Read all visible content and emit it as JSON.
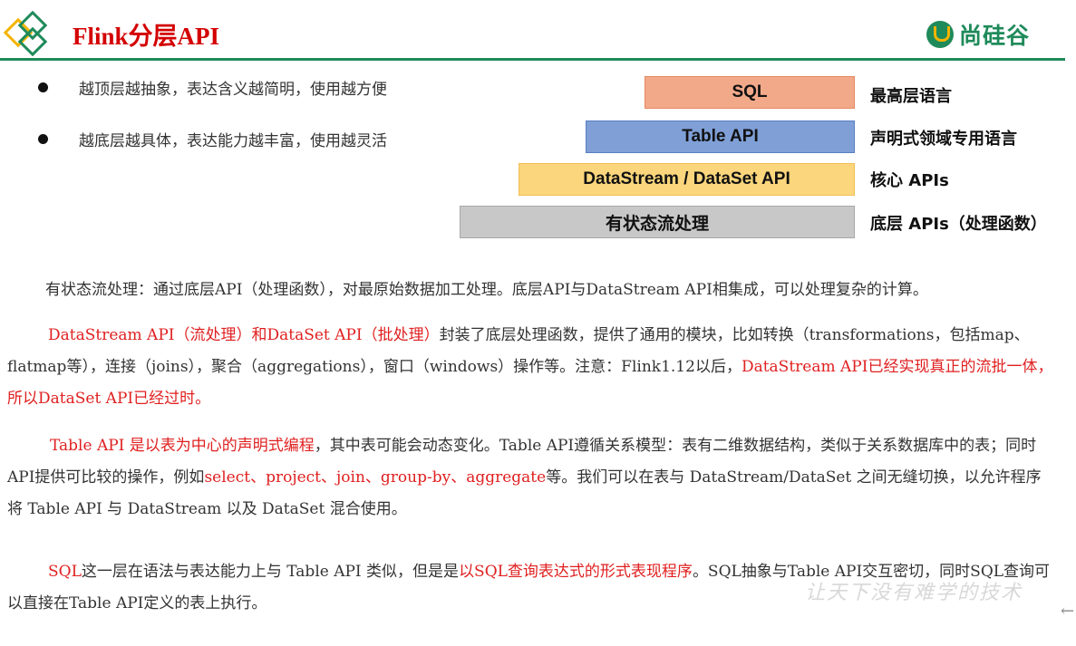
{
  "header": {
    "title": "Flink分层API",
    "brand": "尚硅谷",
    "accent_color": "#1f8a5a",
    "title_color": "#d40000"
  },
  "bullets": [
    "越顶层越抽象，表达含义越简明，使用越方便",
    "越底层越具体，表达能力越丰富，使用越灵活"
  ],
  "layers": [
    {
      "label": "SQL",
      "desc": "最高层语言",
      "color": "#f2a98a"
    },
    {
      "label": "Table API",
      "desc": "声明式领域专用语言",
      "color": "#7f9fd6"
    },
    {
      "label": "DataStream / DataSet API",
      "desc": "核心 APIs",
      "color": "#fbd67c"
    },
    {
      "label": "有状态流处理",
      "desc": "底层 APIs（处理函数）",
      "color": "#c8c8c8"
    }
  ],
  "paragraphs": {
    "p1": "有状态流处理：通过底层API（处理函数），对最原始数据加工处理。底层API与DataStream API相集成，可以处理复杂的计算。",
    "p2_red1": "DataStream API（流处理）和DataSet API（批处理）",
    "p2_text1": "封装了底层处理函数，提供了通用的模块，比如转换（transformations，包括map、flatmap等），连接（joins），聚合（aggregations），窗口（windows）操作等。注意：Flink1.12以后，",
    "p2_red2": "DataStream API已经实现真正的流批一体，所以DataSet API已经过时。",
    "p3_red1": "Table API 是以表为中心的声明式编程",
    "p3_text1": "，其中表可能会动态变化。Table API遵循关系模型：表有二维数据结构，类似于关系数据库中的表；同时API提供可比较的操作，例如",
    "p3_red2": "select、project、join、group-by、aggregate",
    "p3_text2": "等。我们可以在表与 DataStream/DataSet 之间无缝切换，以允许程序将 Table API 与 DataStream 以及 DataSet 混合使用。",
    "p4_red1": "SQL",
    "p4_text1": "这一层在语法与表达能力上与 Table API 类似，但是是",
    "p4_red2": "以SQL查询表达式的形式表现程序",
    "p4_text2": "。SQL抽象与Table API交互密切，同时SQL查询可以直接在Table API定义的表上执行。"
  },
  "watermark": "让天下没有难学的技术",
  "icons": {
    "logo": "diamond-logo-icon",
    "nav": "back-arrow-icon"
  }
}
